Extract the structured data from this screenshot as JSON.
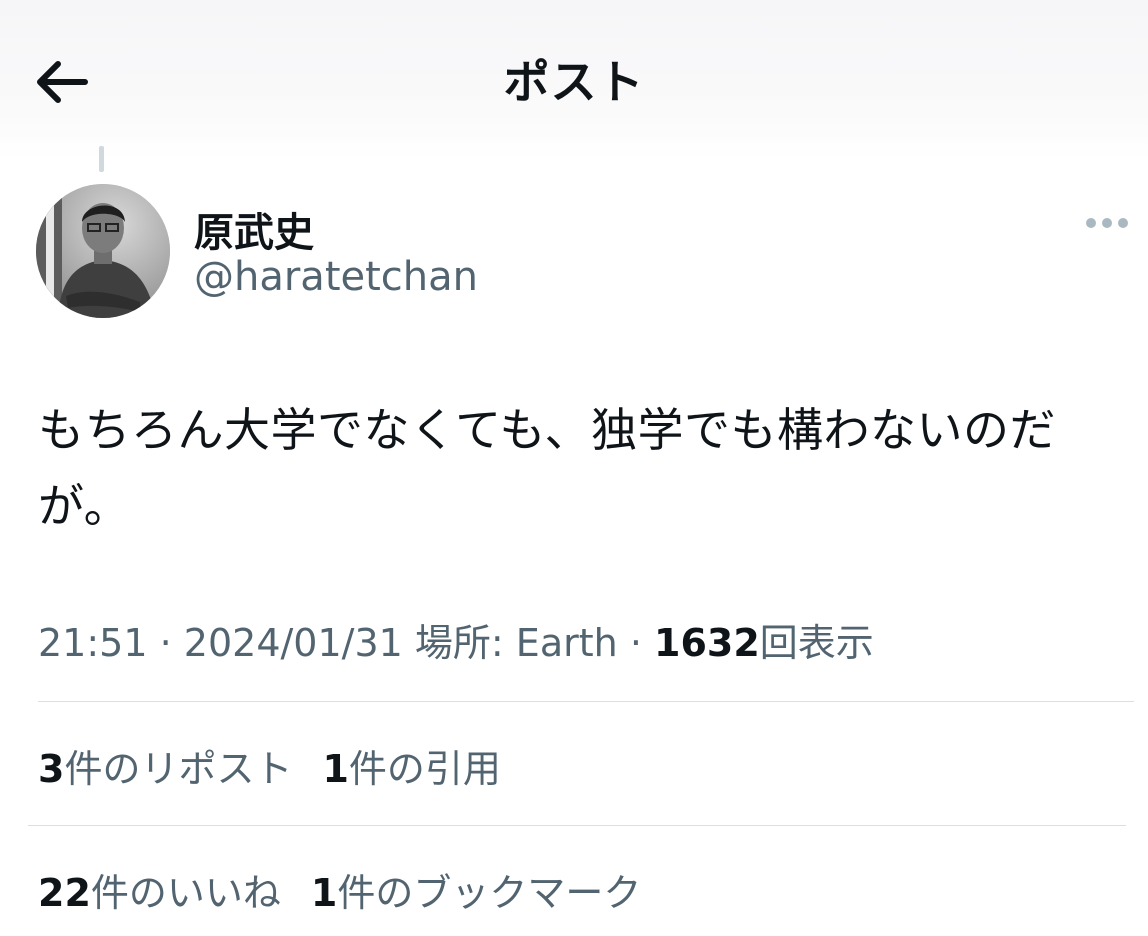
{
  "header": {
    "title": "ポスト"
  },
  "author": {
    "display_name": "原武史",
    "handle": "@haratetchan"
  },
  "tweet": {
    "text_line1": "もちろん大学でなくても、独学でも構わないのだ",
    "text_line2": "が。"
  },
  "meta": {
    "time": "21:51",
    "date": "2024/01/31",
    "location_label": "場所: Earth",
    "view_count": "1632",
    "view_label": "回表示",
    "separator": "·"
  },
  "stats": {
    "reposts_count": "3",
    "reposts_label": "件のリポスト",
    "quotes_count": "1",
    "quotes_label": "件の引用",
    "likes_count": "22",
    "likes_label": "件のいいね",
    "bookmarks_count": "1",
    "bookmarks_label": "件のブックマーク"
  },
  "icons": {
    "back": "back-arrow-icon",
    "more": "more-dots-icon"
  },
  "colors": {
    "text_primary": "#0f1419",
    "text_secondary": "#536471",
    "divider": "#dcdfe2",
    "thread_line": "#cfd9de"
  }
}
